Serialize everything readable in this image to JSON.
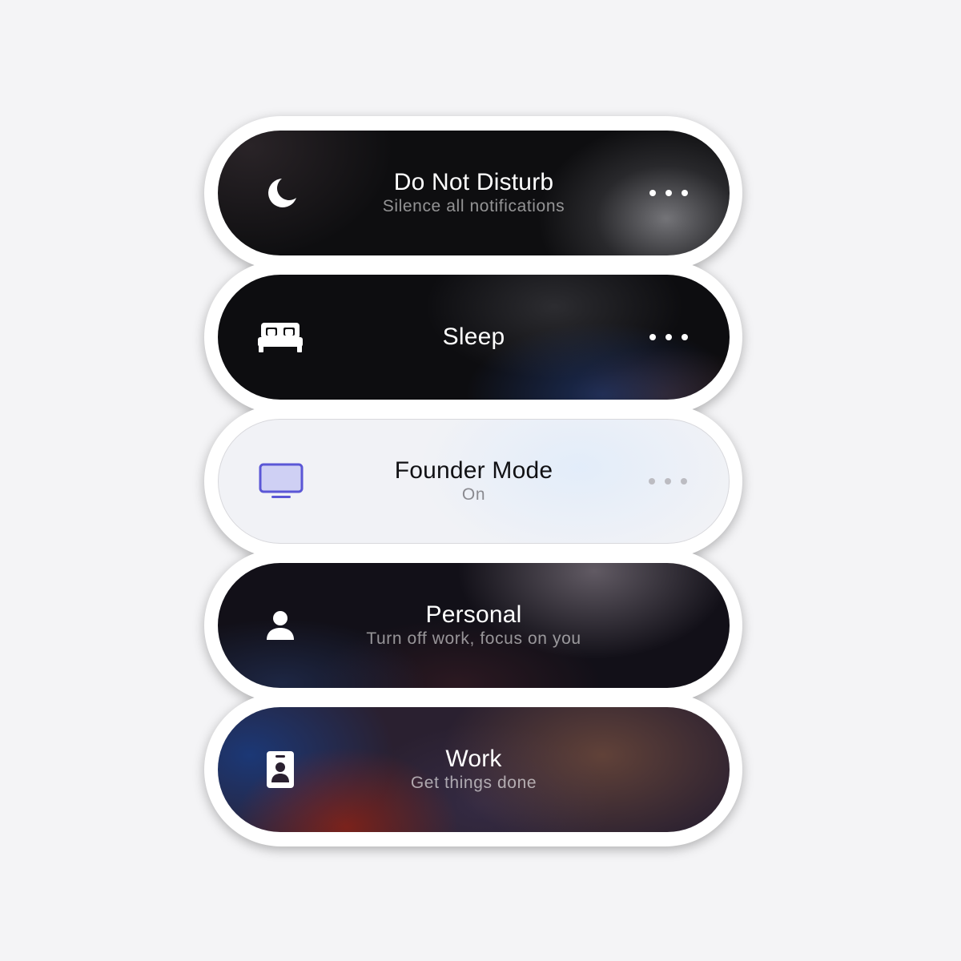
{
  "focus_modes": [
    {
      "title": "Do Not Disturb",
      "subtitle": "Silence all notifications",
      "icon": "moon-icon",
      "has_more_button": true
    },
    {
      "title": "Sleep",
      "subtitle": "",
      "icon": "bed-icon",
      "has_more_button": true
    },
    {
      "title": "Founder Mode",
      "subtitle": "On",
      "icon": "monitor-icon",
      "active": true,
      "accent_color": "#5b57d6",
      "has_more_button": true
    },
    {
      "title": "Personal",
      "subtitle": "Turn off work, focus on you",
      "icon": "person-icon",
      "has_more_button": false
    },
    {
      "title": "Work",
      "subtitle": "Get things done",
      "icon": "id-badge-icon",
      "has_more_button": false
    }
  ],
  "colors": {
    "page_background": "#f4f4f6",
    "sticker_outline": "#ffffff",
    "active_pill_background": "#f1f2f6"
  }
}
